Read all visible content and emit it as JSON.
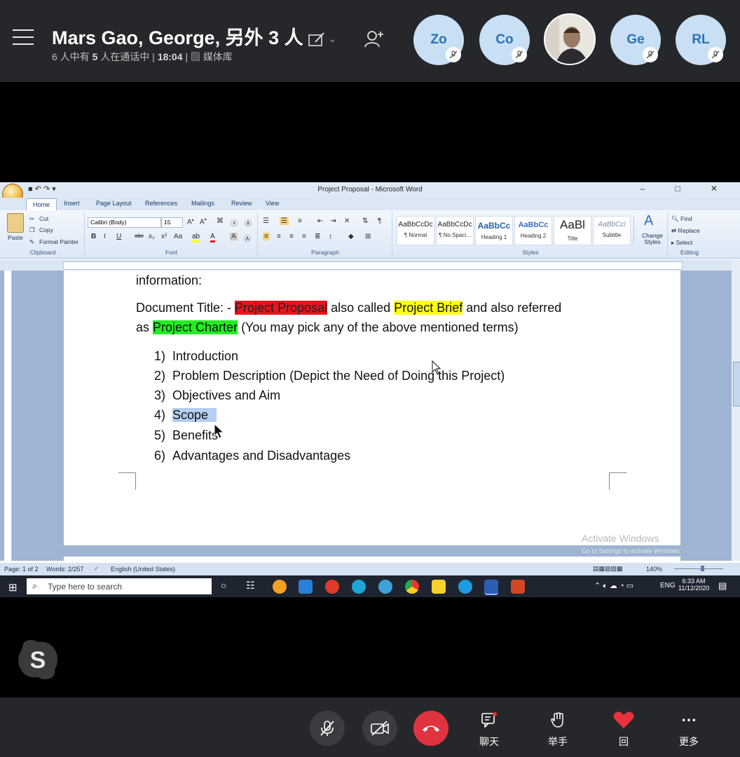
{
  "call": {
    "title": "Mars Gao, George, 另外 3 人",
    "subtitle_prefix": "6 人中有 ",
    "subtitle_count": "5",
    "subtitle_mid": " 人在通话中 | ",
    "duration": "18:04",
    "subtitle_sep": " | ",
    "gallery": "媒体库"
  },
  "participants": [
    {
      "initials": "Zo",
      "muted": true
    },
    {
      "initials": "Co",
      "muted": true
    },
    {
      "initials": "Ge",
      "muted": true
    },
    {
      "initials": "RL",
      "muted": true
    }
  ],
  "word": {
    "quick_access": "■ ↶ ↷ ▾",
    "window_title": "Project Proposal - Microsoft Word",
    "window_controls": "– □ ✕",
    "tabs": [
      "Home",
      "Insert",
      "Page Layout",
      "References",
      "Mailings",
      "Review",
      "View"
    ],
    "clipboard": {
      "paste": "Paste",
      "cut": "Cut",
      "copy": "Copy",
      "format_painter": "Format Painter",
      "label": "Clipboard"
    },
    "font": {
      "name": "Calibri (Body)",
      "size": "15",
      "label": "Font"
    },
    "paragraph_label": "Paragraph",
    "styles": [
      {
        "preview": "AaBbCcDc",
        "name": "¶ Normal"
      },
      {
        "preview": "AaBbCcDc",
        "name": "¶ No Spaci..."
      },
      {
        "preview": "AaBbCc",
        "name": "Heading 1"
      },
      {
        "preview": "AaBbCc",
        "name": "Heading 2"
      },
      {
        "preview": "AaBl",
        "name": "Title"
      },
      {
        "preview": "AaBbCcl",
        "name": "Subtitle"
      }
    ],
    "change_styles": "Change Styles",
    "styles_label": "Styles",
    "editing": {
      "find": "Find",
      "replace": "Replace",
      "select": "Select",
      "label": "Editing"
    },
    "status": {
      "page": "Page: 1 of 2",
      "words": "Words: 2/257",
      "language": "English (United States)",
      "zoom": "140%"
    },
    "watermark": {
      "line1": "Activate Windows",
      "line2": "Go to Settings to activate Windows."
    }
  },
  "document": {
    "line0": "information:",
    "title_prefix": "Document Title: - ",
    "term1": "Project Proposal",
    "mid1": " also called ",
    "term2": "Project Brief",
    "mid2": " and also referred",
    "as": "as ",
    "term3": "Project Charter",
    "tail": " (You may pick any of the above mentioned terms)",
    "items": [
      {
        "num": "1)",
        "text": "Introduction"
      },
      {
        "num": "2)",
        "text": "Problem Description (Depict the Need of Doing this Project)"
      },
      {
        "num": "3)",
        "text": "Objectives and Aim"
      },
      {
        "num": "4)",
        "text": "Scope"
      },
      {
        "num": "5)",
        "text": "Benefits"
      },
      {
        "num": "6)",
        "text": "Advantages and Disadvantages"
      }
    ]
  },
  "taskbar": {
    "search_placeholder": "Type here to search",
    "language": "ENG",
    "time": "6:33 AM",
    "date": "11/12/2020"
  },
  "controls": {
    "chat": "聊天",
    "raise_hand": "举手",
    "react": "回",
    "more": "更多"
  }
}
